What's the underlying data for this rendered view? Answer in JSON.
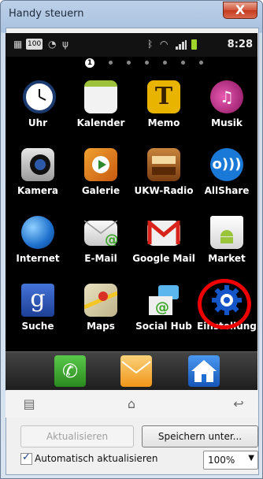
{
  "window": {
    "title": "Handy steuern",
    "close_glyph": "X"
  },
  "status_bar": {
    "icons": [
      "gallery-icon",
      "counter-icon",
      "sync-icon",
      "usb-icon",
      "bluetooth-icon",
      "wifi-icon",
      "signal-icon",
      "battery-icon"
    ],
    "counter_text": "100",
    "time": "8:28"
  },
  "home_page": {
    "active_page": "1",
    "page_count": 7
  },
  "apps": [
    {
      "label": "Uhr",
      "icon": "clock-icon",
      "color": "#1b3a6e"
    },
    {
      "label": "Kalender",
      "icon": "calendar-icon",
      "color": "#f2f2f2"
    },
    {
      "label": "Memo",
      "icon": "memo-icon",
      "color": "#e8b400"
    },
    {
      "label": "Musik",
      "icon": "music-icon",
      "color": "#b8227e"
    },
    {
      "label": "Kamera",
      "icon": "camera-icon",
      "color": "#2b2b2b"
    },
    {
      "label": "Galerie",
      "icon": "gallery-icon",
      "color": "#e07a16"
    },
    {
      "label": "UKW-Radio",
      "icon": "radio-icon",
      "color": "#b06a2a"
    },
    {
      "label": "AllShare",
      "icon": "allshare-icon",
      "color": "#1a78d6"
    },
    {
      "label": "Internet",
      "icon": "globe-icon",
      "color": "#1d6fcc"
    },
    {
      "label": "E-Mail",
      "icon": "email-icon",
      "color": "#e8e8e8"
    },
    {
      "label": "Google Mail",
      "icon": "gmail-icon",
      "color": "#f0f0f0"
    },
    {
      "label": "Market",
      "icon": "market-icon",
      "color": "#eeeeee"
    },
    {
      "label": "Suche",
      "icon": "search-icon",
      "color": "#2a54b8"
    },
    {
      "label": "Maps",
      "icon": "maps-icon",
      "color": "#d9d2b6"
    },
    {
      "label": "Social Hub",
      "icon": "social-hub-icon",
      "color": "#3e9a3a"
    },
    {
      "label": "Einstellung",
      "icon": "gear-icon",
      "color": "#1456c8"
    }
  ],
  "dock": [
    {
      "icon": "phone-icon",
      "color": "#3daa2e"
    },
    {
      "icon": "messages-icon",
      "color": "#f4a62a"
    },
    {
      "icon": "home-icon",
      "color": "#1f6ed4"
    }
  ],
  "nav": {
    "menu_icon": "menu-icon",
    "home_icon": "home-outline-icon",
    "back_icon": "back-icon"
  },
  "controls": {
    "refresh_button": "Aktualisieren",
    "save_button": "Speichern unter...",
    "auto_refresh_label": "Automatisch aktualisieren",
    "auto_refresh_checked": true,
    "zoom_value": "100%"
  },
  "highlight": {
    "target": "Einstellung",
    "color": "#e00000"
  }
}
